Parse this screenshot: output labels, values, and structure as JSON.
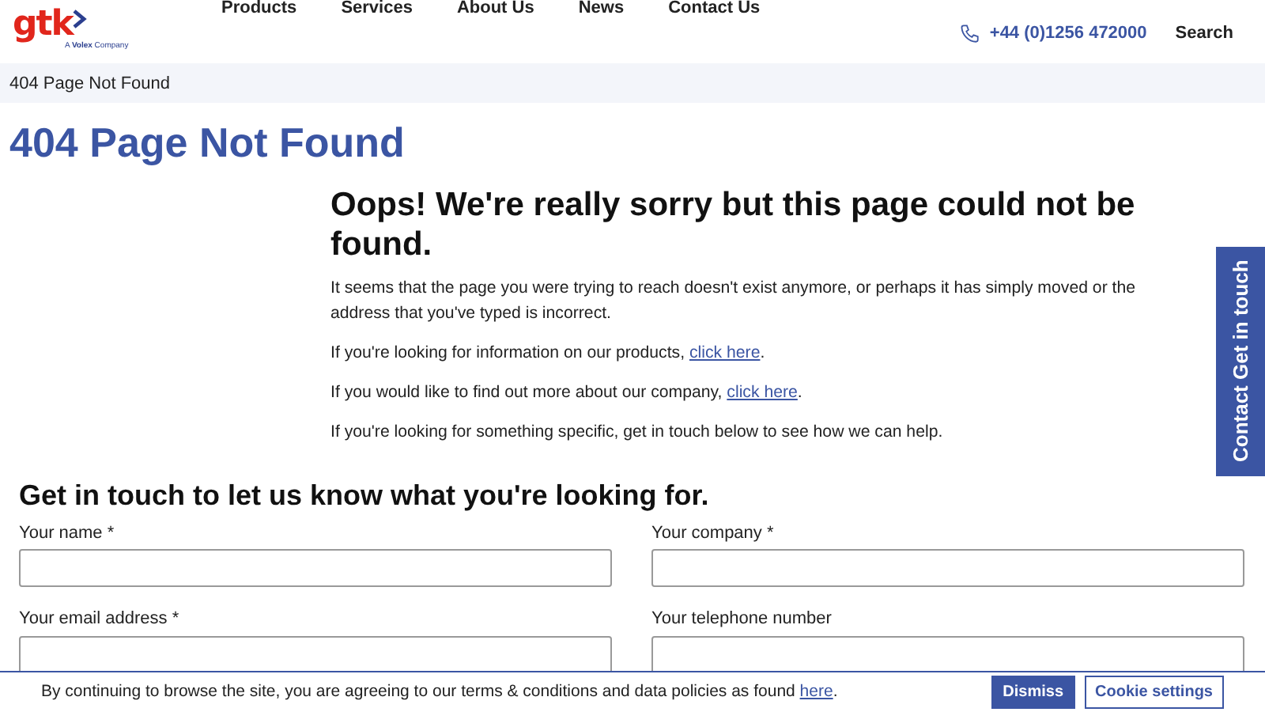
{
  "header": {
    "logo": {
      "text": "gtk",
      "tagline_prefix": "A",
      "tagline_brand": "Volex",
      "tagline_suffix": "Company"
    },
    "nav": [
      "Products",
      "Services",
      "About Us",
      "News",
      "Contact Us"
    ],
    "phone": "+44 (0)1256 472000",
    "search": "Search"
  },
  "breadcrumb": "404 Page Not Found",
  "page_title": "404 Page Not Found",
  "message": {
    "heading": "Oops! We're really sorry but this page could not be found.",
    "paragraphs": [
      {
        "text": "It seems that the page you were trying to reach doesn't exist anymore, or perhaps it has simply moved or the address that you've typed is incorrect."
      },
      {
        "text": "If you're looking for information on our products, ",
        "link": "click here",
        "after": "."
      },
      {
        "text": "If you would like to find out more about our company, ",
        "link": "click here",
        "after": "."
      },
      {
        "text": "If you're looking for something specific, get in touch below to see how we can help."
      }
    ]
  },
  "form": {
    "heading": "Get in touch to let us know what you're looking for.",
    "fields": [
      {
        "label": "Your name *"
      },
      {
        "label": "Your company *"
      },
      {
        "label": "Your email address *"
      },
      {
        "label": "Your telephone number"
      }
    ]
  },
  "side_tab": "Contact Get in touch",
  "cookie_bar": {
    "text": "By continuing to browse the site, you are agreeing to our terms & conditions and data policies as found ",
    "link": "here",
    "after": ".",
    "buttons": [
      {
        "label": "Dismiss",
        "kind": "primary"
      },
      {
        "label": "Cookie settings",
        "kind": "outline"
      }
    ]
  }
}
